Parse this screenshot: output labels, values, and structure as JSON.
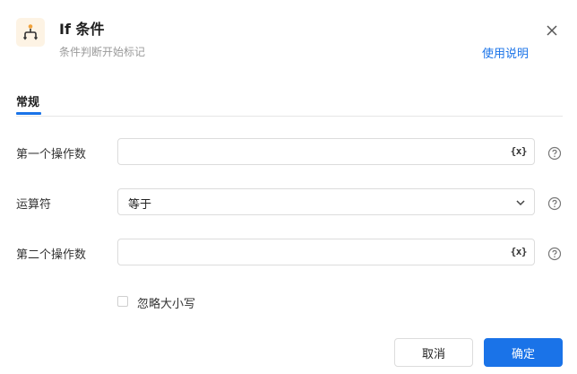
{
  "header": {
    "title": "If 条件",
    "subtitle": "条件判断开始标记",
    "help_link": "使用说明",
    "icon": "branch-icon"
  },
  "tabs": [
    {
      "label": "常规",
      "active": true
    }
  ],
  "fields": {
    "operand1": {
      "label": "第一个操作数",
      "value": "",
      "var_icon_text": "{x}"
    },
    "operator": {
      "label": "运算符",
      "value": "等于"
    },
    "operand2": {
      "label": "第二个操作数",
      "value": "",
      "var_icon_text": "{x}"
    }
  },
  "options": {
    "ignore_case": {
      "label": "忽略大小写",
      "checked": false
    }
  },
  "footer": {
    "cancel_label": "取消",
    "ok_label": "确定"
  },
  "colors": {
    "accent": "#1a73e8",
    "icon_bg": "#fdf3e4",
    "icon_dot": "#f0a13a"
  }
}
